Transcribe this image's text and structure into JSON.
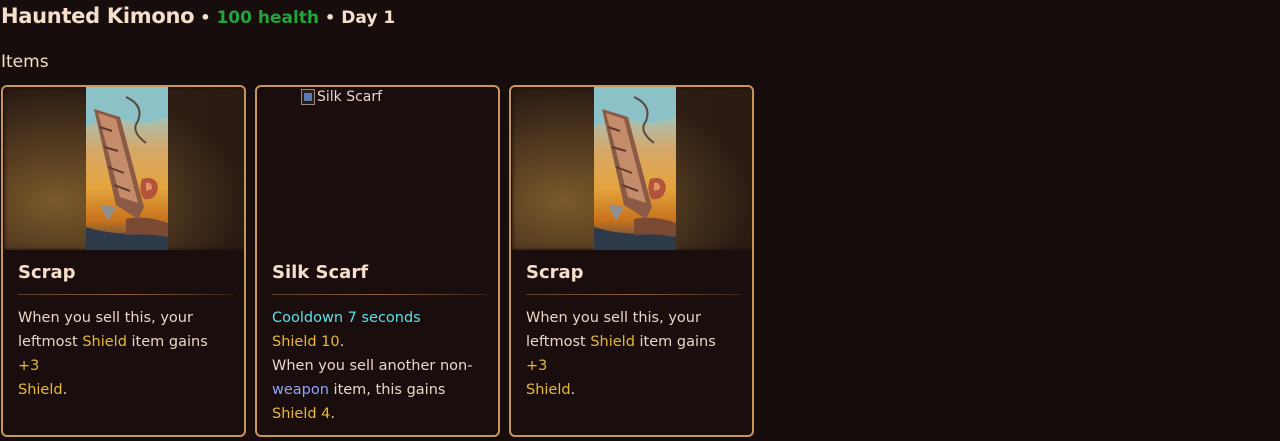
{
  "header": {
    "title": "Haunted Kimono",
    "separator": "•",
    "health": "100 health",
    "day": "Day 1"
  },
  "colors": {
    "background": "#160d0c",
    "card_border": "#c9965a",
    "health": "#23a33b",
    "shield": "#e7b93a",
    "cooldown": "#5fe0e8",
    "weapon": "#8ea5ff"
  },
  "section": {
    "title": "Items"
  },
  "items": [
    {
      "name": "Scrap",
      "image_alt": "Scrap",
      "desc": {
        "l1": "When you sell this, your",
        "l2_pre": "leftmost ",
        "l2_kw": "Shield",
        "l2_mid": " item gains ",
        "l2_val": "+3",
        "l3_kw": "Shield",
        "l3_post": "."
      }
    },
    {
      "name": "Silk Scarf",
      "image_alt": "Silk Scarf",
      "desc": {
        "cooldown": "Cooldown 7 seconds",
        "shield_kw": "Shield 10",
        "shield_post": ".",
        "l3": "When you sell another non-",
        "l4_kw": "weapon",
        "l4_post": " item, this gains",
        "l5_kw": "Shield 4",
        "l5_post": "."
      }
    },
    {
      "name": "Scrap",
      "image_alt": "Scrap",
      "desc": {
        "l1": "When you sell this, your",
        "l2_pre": "leftmost ",
        "l2_kw": "Shield",
        "l2_mid": " item gains ",
        "l2_val": "+3",
        "l3_kw": "Shield",
        "l3_post": "."
      }
    }
  ]
}
